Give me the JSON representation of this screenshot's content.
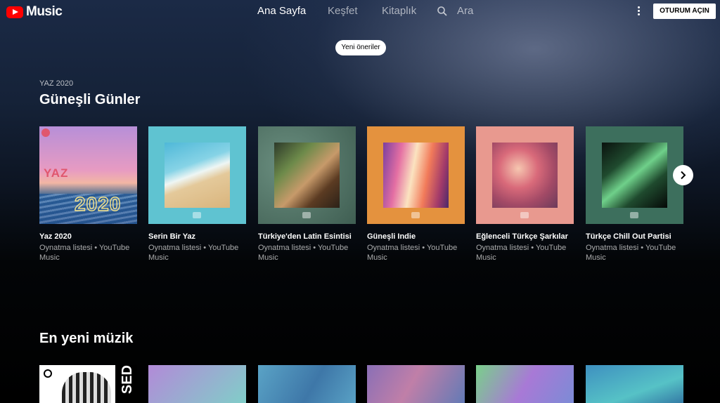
{
  "app": {
    "logo_text": "Music",
    "brand_color": "#ff0000"
  },
  "nav": {
    "items": [
      {
        "label": "Ana Sayfa",
        "active": true
      },
      {
        "label": "Keşfet",
        "active": false
      },
      {
        "label": "Kitaplık",
        "active": false
      }
    ],
    "search_label": "Ara",
    "signin_label": "OTURUM AÇIN"
  },
  "chip": {
    "label": "Yeni öneriler"
  },
  "section1": {
    "eyebrow": "YAZ 2020",
    "title": "Güneşli Günler",
    "cards": [
      {
        "title": "Yaz 2020",
        "subtitle": "Oynatma listesi • YouTube Music",
        "art_text_top": "YAZ",
        "art_text_bottom": "2020"
      },
      {
        "title": "Serin Bir Yaz",
        "subtitle": "Oynatma listesi • YouTube Music"
      },
      {
        "title": "Türkiye'den Latin Esintisi",
        "subtitle": "Oynatma listesi • YouTube Music"
      },
      {
        "title": "Güneşli Indie",
        "subtitle": "Oynatma listesi • YouTube Music"
      },
      {
        "title": "Eğlenceli Türkçe Şarkılar",
        "subtitle": "Oynatma listesi • YouTube Music"
      },
      {
        "title": "Türkçe Chill Out Partisi",
        "subtitle": "Oynatma listesi • YouTube Music"
      }
    ]
  },
  "section2": {
    "title": "En yeni müzik",
    "cards": [
      {
        "art_text": "SED"
      },
      {},
      {},
      {},
      {},
      {}
    ]
  }
}
